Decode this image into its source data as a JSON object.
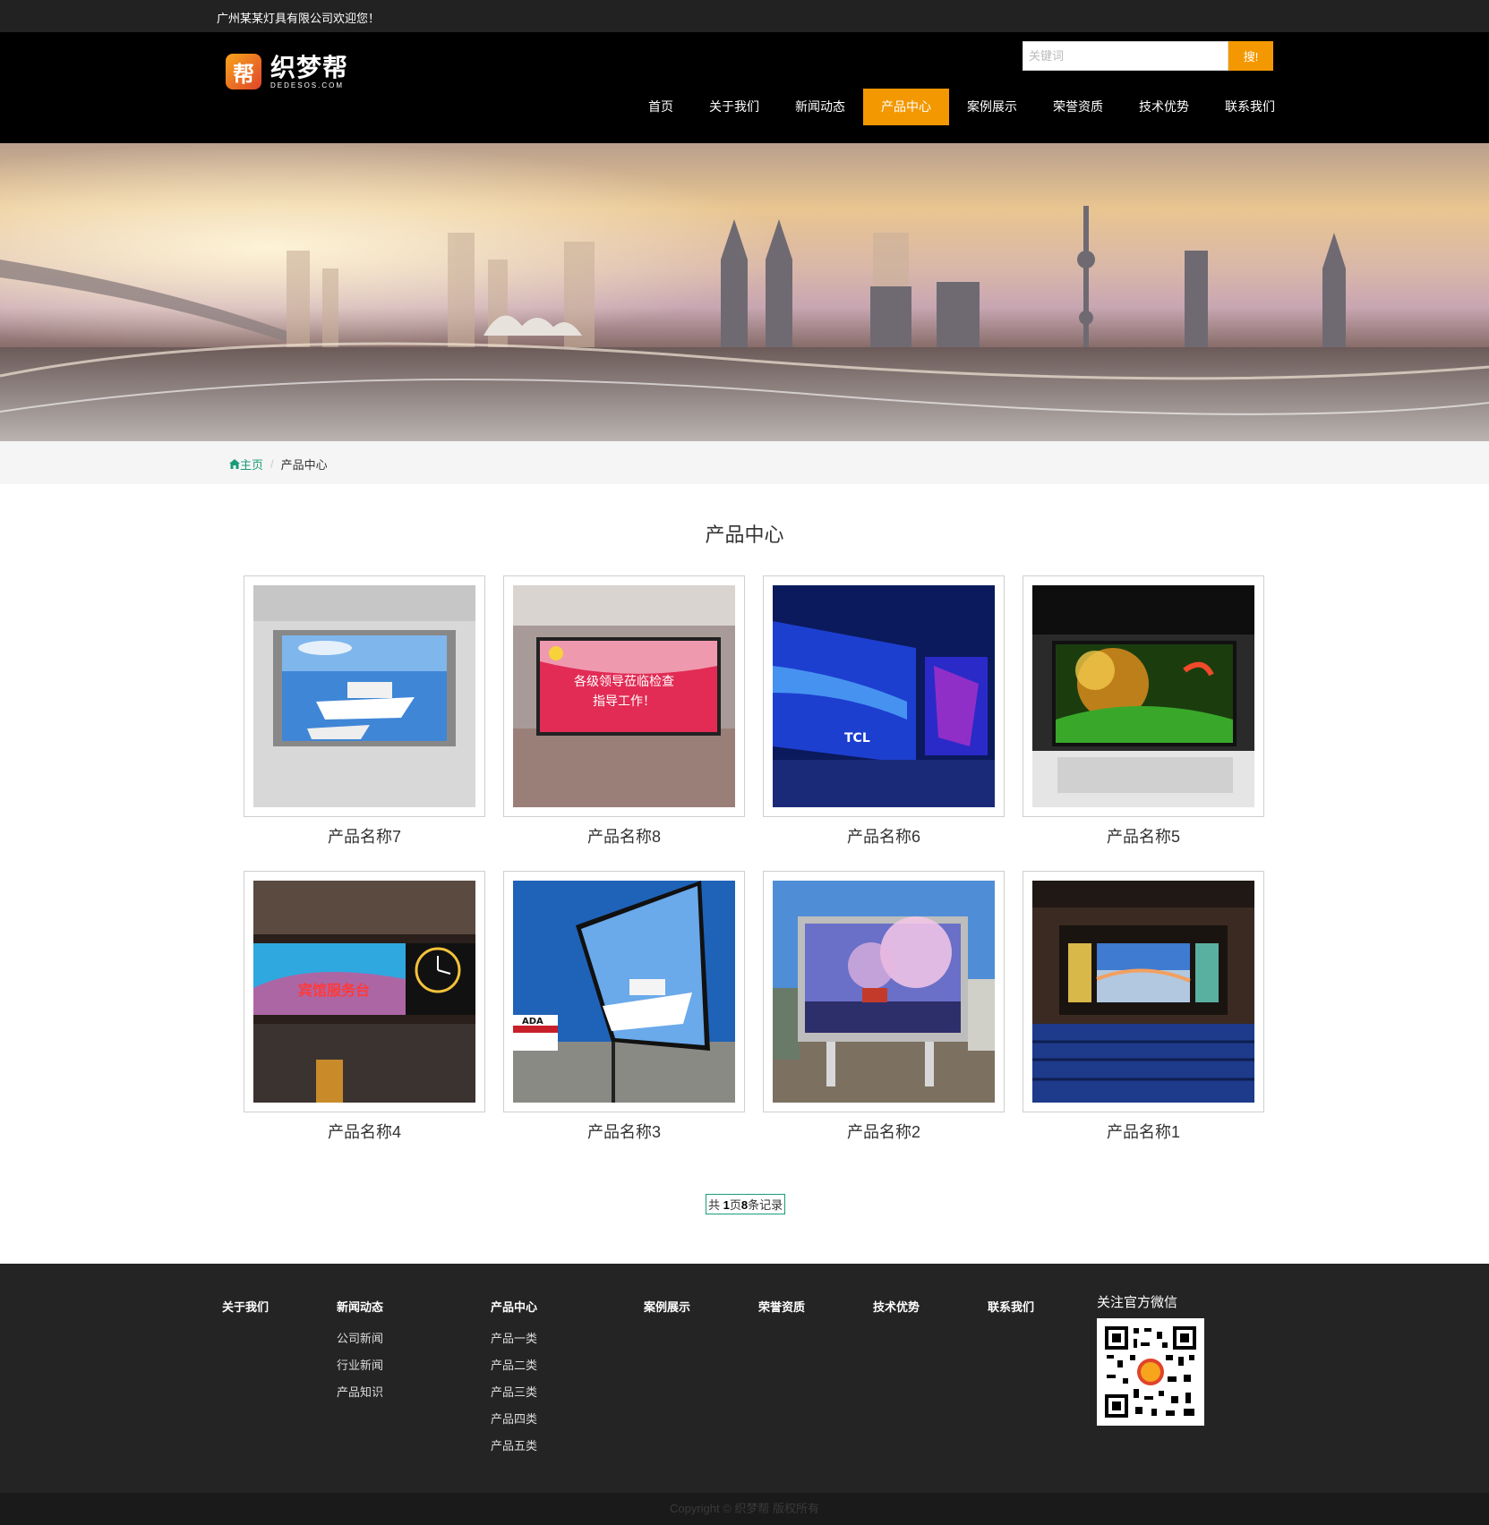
{
  "topbar": {
    "welcome": "广州某某灯具有限公司欢迎您！"
  },
  "header": {
    "logo": {
      "mark": "帮",
      "name": "织梦帮",
      "sub": "DEDESOS.COM"
    },
    "search": {
      "placeholder": "关键词",
      "button": "搜!"
    },
    "nav": [
      {
        "label": "首页",
        "active": false
      },
      {
        "label": "关于我们",
        "active": false
      },
      {
        "label": "新闻动态",
        "active": false
      },
      {
        "label": "产品中心",
        "active": true
      },
      {
        "label": "案例展示",
        "active": false
      },
      {
        "label": "荣誉资质",
        "active": false
      },
      {
        "label": "技术优势",
        "active": false
      },
      {
        "label": "联系我们",
        "active": false
      }
    ],
    "accent": "#f39800"
  },
  "breadcrumb": {
    "home": "主页",
    "current": "产品中心",
    "home_color": "#1a9c78"
  },
  "main": {
    "title": "产品中心",
    "products": [
      {
        "name": "产品名称7",
        "image": "screen-yacht-indoor"
      },
      {
        "name": "产品名称8",
        "image": "screen-red-banner"
      },
      {
        "name": "产品名称6",
        "image": "screen-blue-hall"
      },
      {
        "name": "产品名称5",
        "image": "screen-night-tree"
      },
      {
        "name": "产品名称4",
        "image": "screen-service-desk"
      },
      {
        "name": "产品名称3",
        "image": "screen-yacht-outdoor"
      },
      {
        "name": "产品名称2",
        "image": "screen-cherry-blossom"
      },
      {
        "name": "产品名称1",
        "image": "screen-auditorium"
      }
    ],
    "pager": {
      "prefix": "共 ",
      "pages": "1",
      "mid": "页",
      "records": "8",
      "suffix": "条记录"
    }
  },
  "footer": {
    "columns": [
      {
        "title": "关于我们",
        "items": []
      },
      {
        "title": "新闻动态",
        "items": [
          "公司新闻",
          "行业新闻",
          "产品知识"
        ]
      },
      {
        "title": "产品中心",
        "items": [
          "产品一类",
          "产品二类",
          "产品三类",
          "产品四类",
          "产品五类"
        ]
      },
      {
        "title": "案例展示",
        "items": []
      },
      {
        "title": "荣誉资质",
        "items": []
      },
      {
        "title": "技术优势",
        "items": []
      },
      {
        "title": "联系我们",
        "items": []
      }
    ],
    "wechat": {
      "title": "关注官方微信"
    },
    "copyright": "Copyright © 织梦帮 版权所有"
  }
}
